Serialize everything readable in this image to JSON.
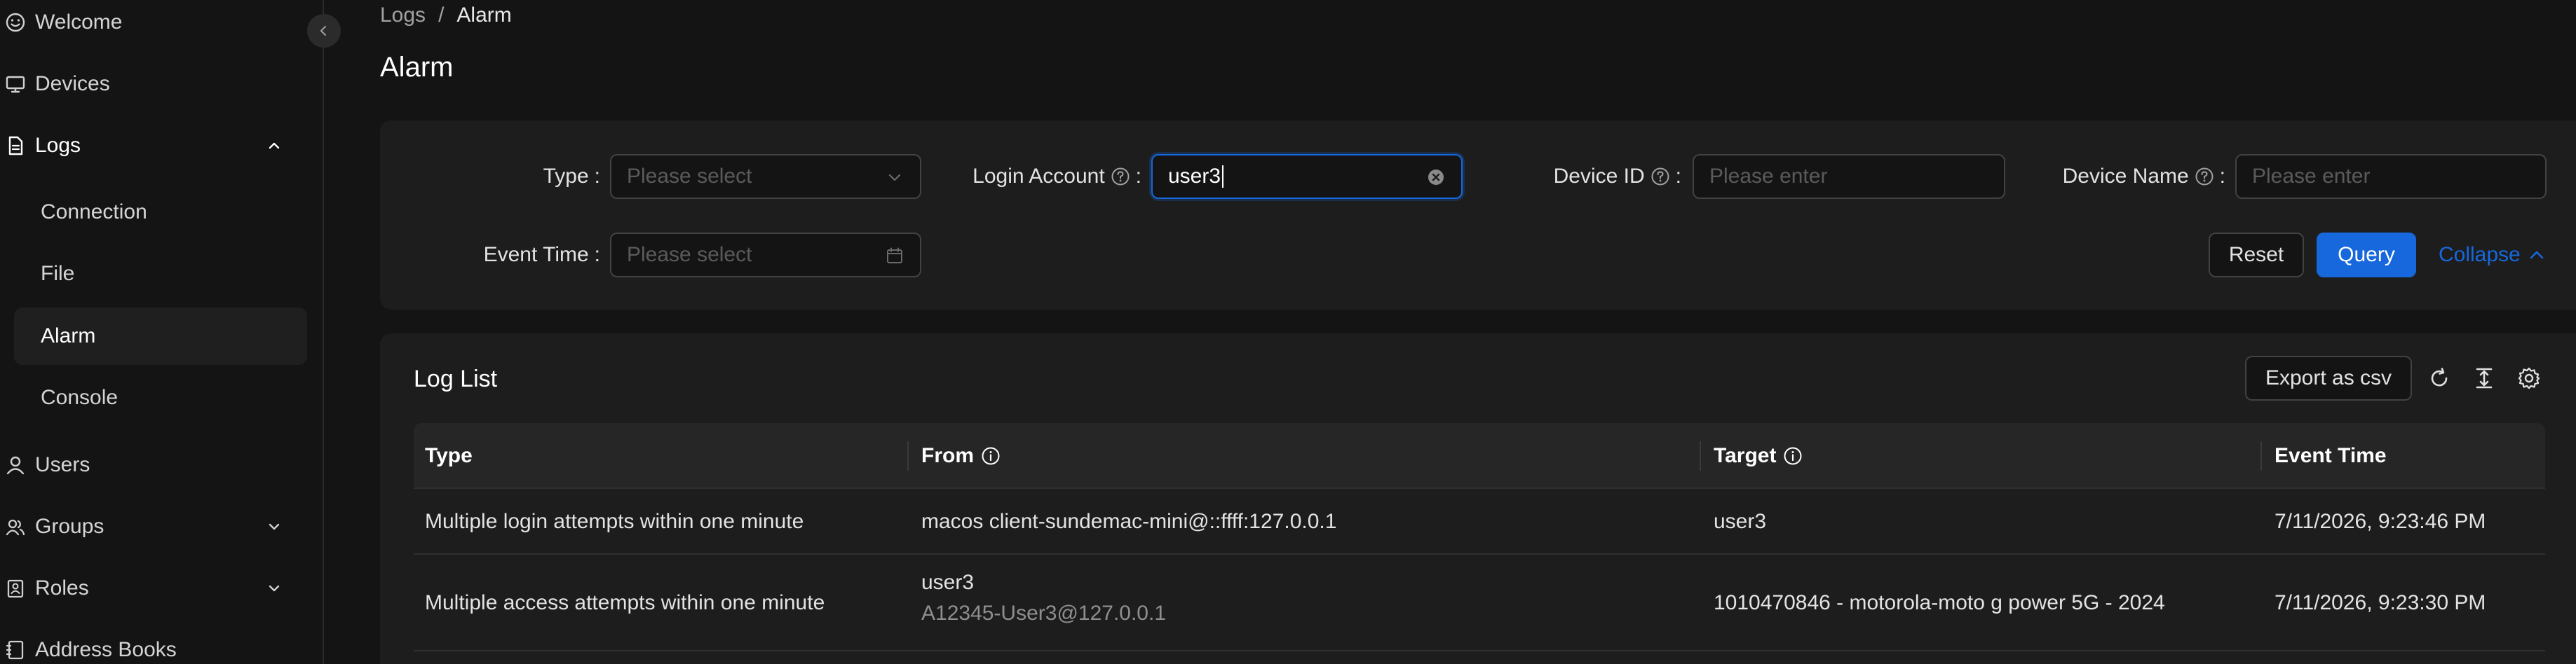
{
  "sidebar": {
    "items": [
      {
        "label": "Welcome",
        "icon": "smile-icon"
      },
      {
        "label": "Devices",
        "icon": "monitor-icon"
      },
      {
        "label": "Logs",
        "icon": "file-icon",
        "expanded": true,
        "children": [
          {
            "label": "Connection"
          },
          {
            "label": "File"
          },
          {
            "label": "Alarm",
            "active": true
          },
          {
            "label": "Console"
          }
        ]
      },
      {
        "label": "Users",
        "icon": "user-icon"
      },
      {
        "label": "Groups",
        "icon": "team-icon",
        "expanded": false
      },
      {
        "label": "Roles",
        "icon": "roles-icon",
        "expanded": false
      },
      {
        "label": "Address Books",
        "icon": "address-book-icon"
      }
    ]
  },
  "breadcrumb": {
    "parent": "Logs",
    "separator": "/",
    "current": "Alarm"
  },
  "page": {
    "title": "Alarm"
  },
  "filters": {
    "type": {
      "label": "Type",
      "placeholder": "Please select"
    },
    "login_account": {
      "label": "Login Account",
      "value": "user3"
    },
    "device_id": {
      "label": "Device ID",
      "placeholder": "Please enter"
    },
    "device_name": {
      "label": "Device Name",
      "placeholder": "Please enter"
    },
    "event_time": {
      "label": "Event Time",
      "placeholder": "Please select"
    },
    "colon": ":",
    "reset_label": "Reset",
    "query_label": "Query",
    "collapse_label": "Collapse"
  },
  "log_list": {
    "title": "Log List",
    "export_label": "Export as csv",
    "columns": [
      "Type",
      "From",
      "Target",
      "Event Time"
    ],
    "rows": [
      {
        "type": "Multiple login attempts within one minute",
        "from": "macos client-sundemac-mini@::ffff:127.0.0.1",
        "from_sub": "",
        "target": "user3",
        "event_time": "7/11/2026, 9:23:46 PM"
      },
      {
        "type": "Multiple access attempts within one minute",
        "from": "user3",
        "from_sub": "A12345-User3@127.0.0.1",
        "target": "1010470846 - motorola-moto g power 5G - 2024",
        "event_time": "7/11/2026, 9:23:30 PM"
      }
    ]
  },
  "colors": {
    "accent": "#1668dc",
    "background": "#141414",
    "panel": "#1d1d1d"
  }
}
